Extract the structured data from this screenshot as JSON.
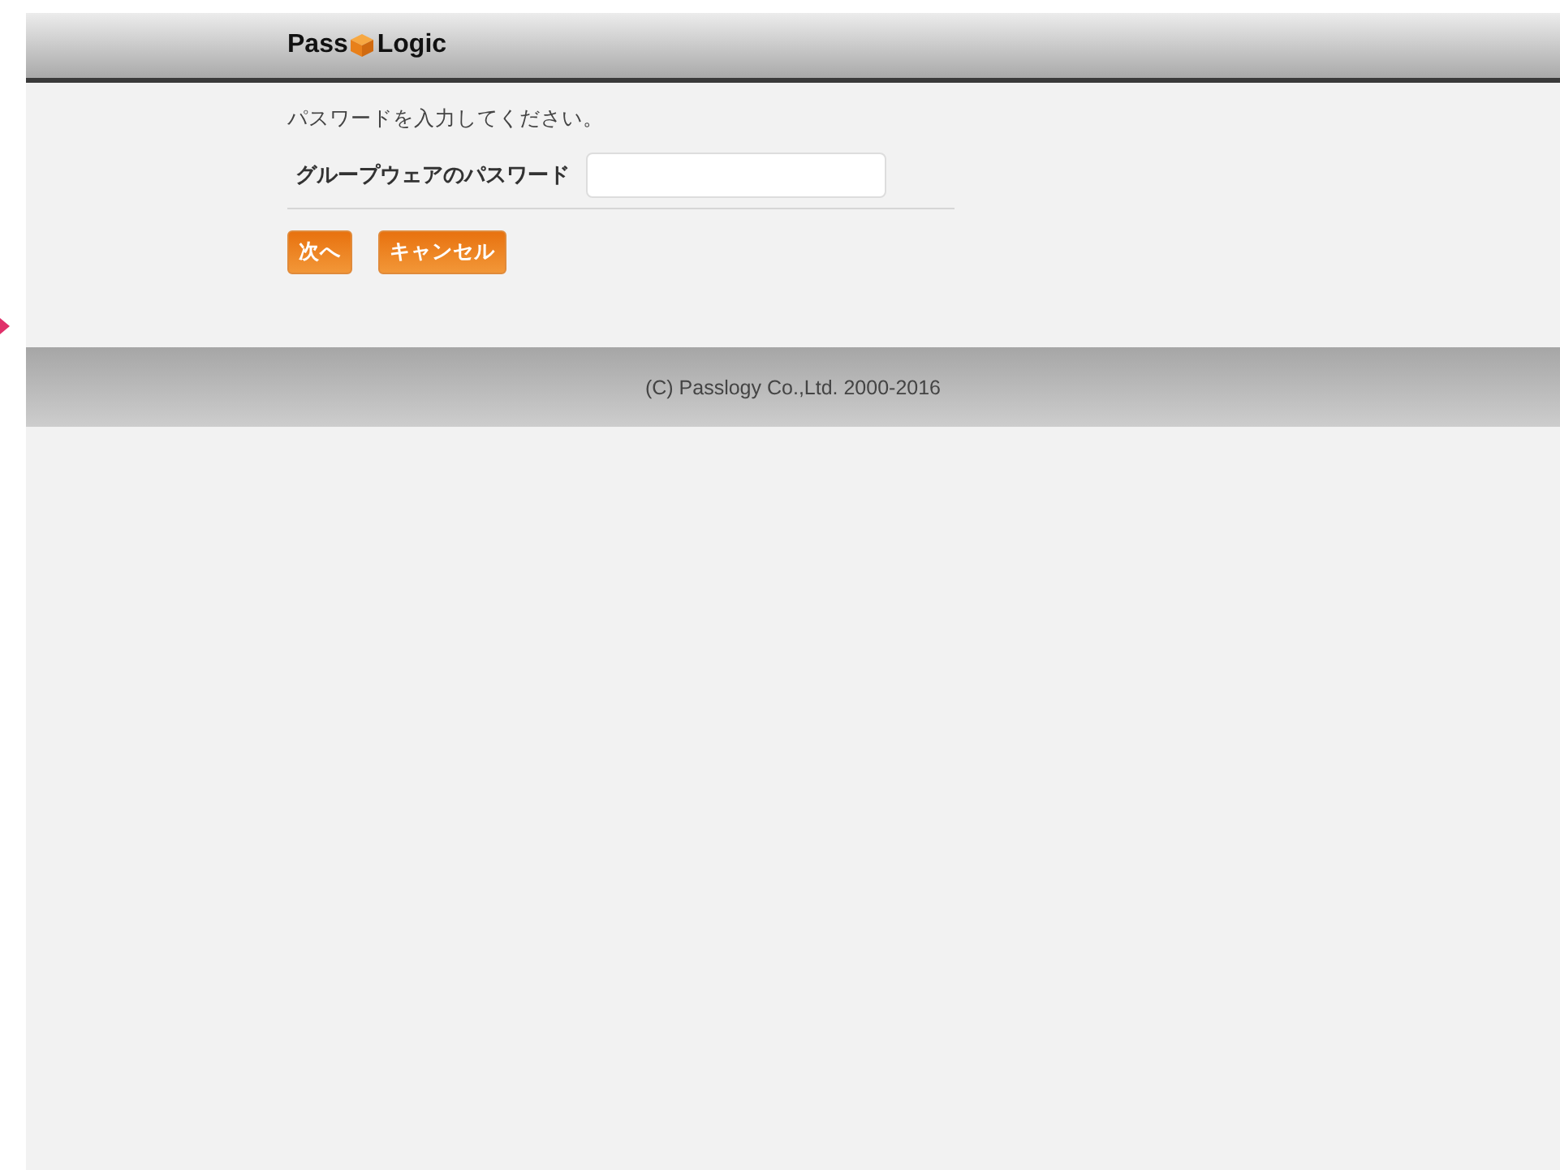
{
  "header": {
    "logo_left": "Pass",
    "logo_right": "Logic"
  },
  "prompt": "パスワードを入力してください。",
  "field": {
    "label": "グループウェアのパスワード"
  },
  "buttons": [
    "次へ",
    "キャンセル"
  ],
  "footer": "(C) Passlogy Co.,Ltd. 2000-2016"
}
